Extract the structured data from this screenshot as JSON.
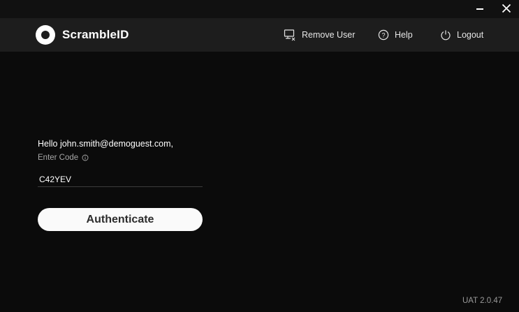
{
  "window_controls": {
    "minimize_icon": "minimize-icon",
    "close_icon": "close-icon"
  },
  "header": {
    "brand_name": "ScrambleID",
    "logo_icon": "scrambleid-logo",
    "nav": {
      "remove_user": {
        "label": "Remove User",
        "icon": "remove-user-icon"
      },
      "help": {
        "label": "Help",
        "icon": "help-icon"
      },
      "logout": {
        "label": "Logout",
        "icon": "power-icon"
      }
    }
  },
  "main": {
    "greeting": "Hello john.smith@demoguest.com,",
    "code_label": "Enter Code",
    "code_value": "C42YEV",
    "authenticate_label": "Authenticate"
  },
  "footer": {
    "version": "UAT 2.0.47"
  },
  "colors": {
    "background": "#0b0b0b",
    "header": "#1d1d1d",
    "button_bg": "#fafafa",
    "button_text": "#2c2c2c"
  }
}
